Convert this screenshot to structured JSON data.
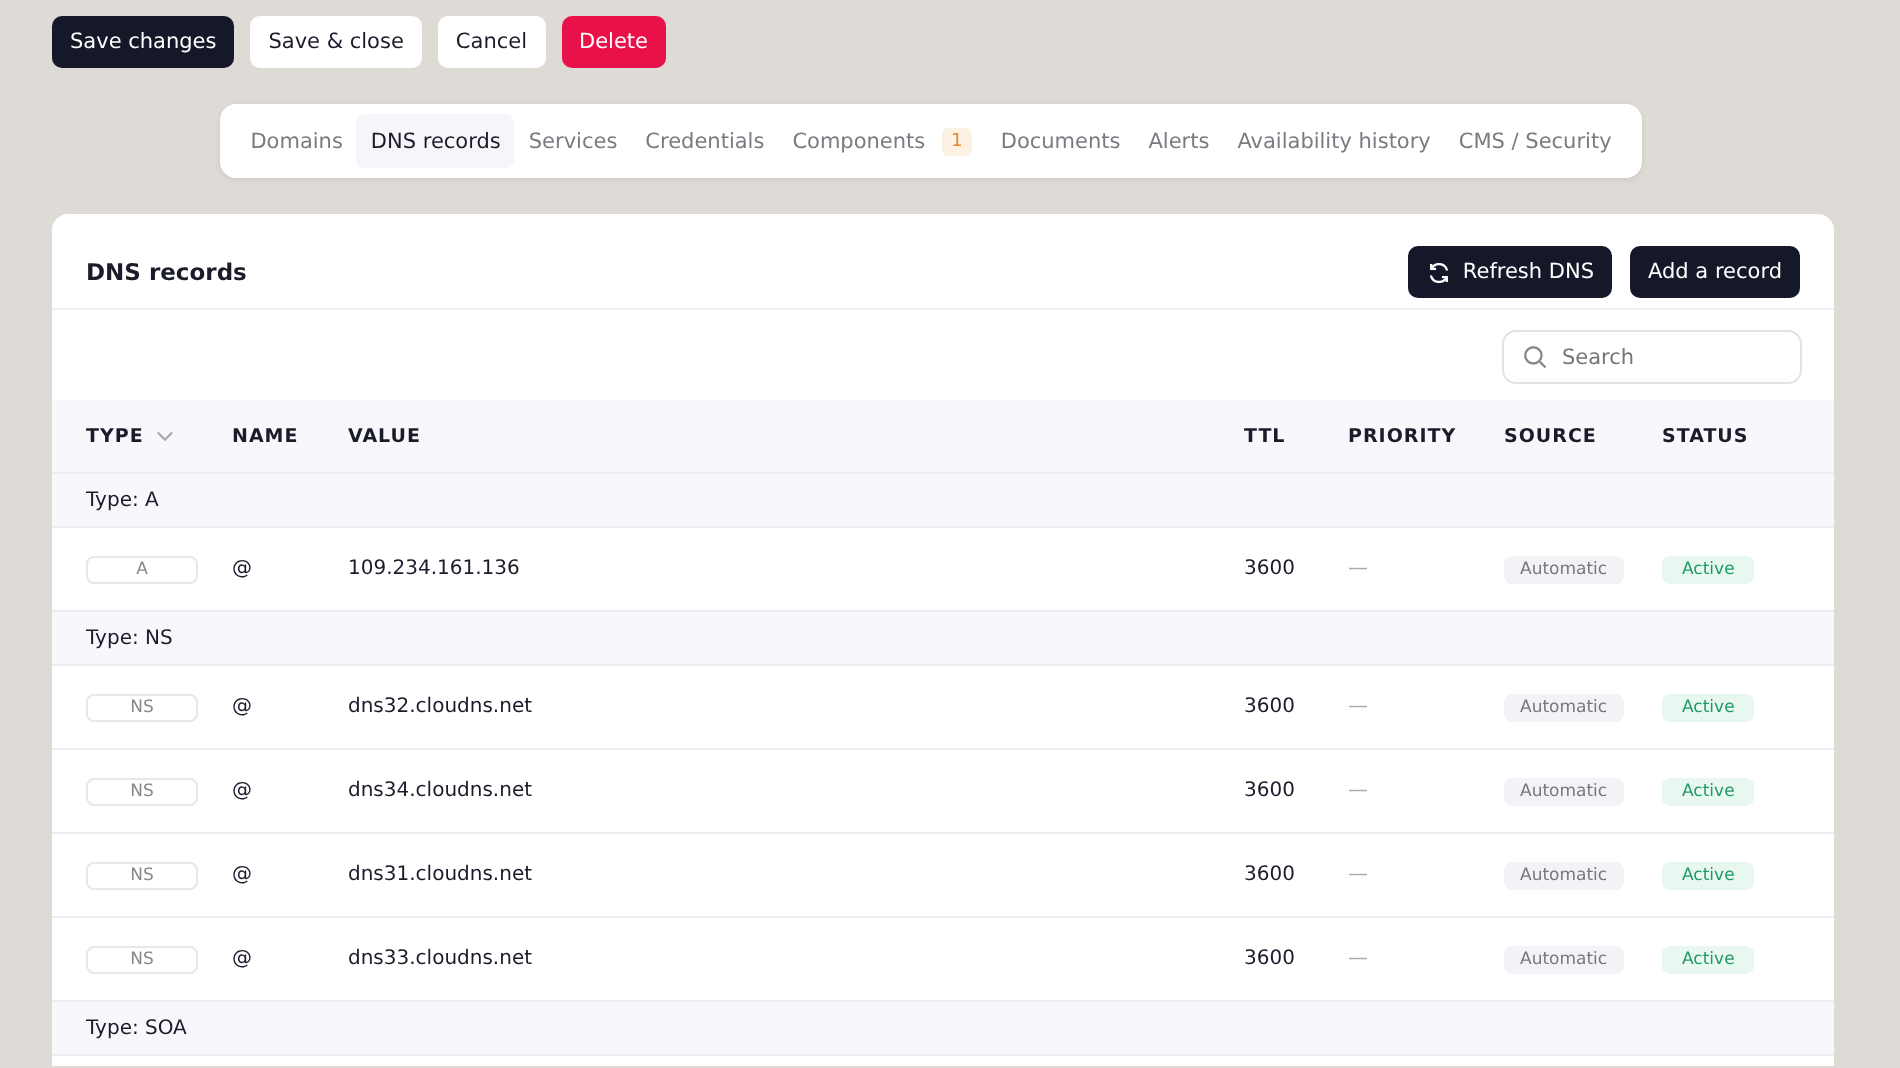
{
  "actions": [
    {
      "label": "Save changes",
      "kind": "primary"
    },
    {
      "label": "Save & close",
      "kind": "secondary"
    },
    {
      "label": "Cancel",
      "kind": "secondary"
    },
    {
      "label": "Delete",
      "kind": "danger"
    }
  ],
  "tabs": [
    {
      "label": "Domains",
      "selected": false
    },
    {
      "label": "DNS records",
      "selected": true
    },
    {
      "label": "Services",
      "selected": false
    },
    {
      "label": "Credentials",
      "selected": false
    },
    {
      "label": "Components",
      "selected": false,
      "badge": "1"
    },
    {
      "label": "Documents",
      "selected": false
    },
    {
      "label": "Alerts",
      "selected": false
    },
    {
      "label": "Availability history",
      "selected": false
    },
    {
      "label": "CMS / Security",
      "selected": false
    }
  ],
  "card": {
    "title": "DNS records",
    "buttons": [
      {
        "label": "Refresh DNS",
        "kind": "refresh"
      },
      {
        "label": "Add a record"
      }
    ],
    "search": {
      "placeholder": "Search"
    }
  },
  "table": {
    "columns": [
      {
        "label": "TYPE",
        "sortable": true
      },
      {
        "label": "NAME"
      },
      {
        "label": "VALUE"
      },
      {
        "label": "TTL"
      },
      {
        "label": "PRIORITY"
      },
      {
        "label": "SOURCE"
      },
      {
        "label": "STATUS"
      }
    ],
    "rows": [
      {
        "kind": "group",
        "label": "Type: A"
      },
      {
        "kind": "record",
        "type": "A",
        "name": "@",
        "value": "109.234.161.136",
        "ttl": "3600",
        "priority": "—",
        "source": "Automatic",
        "status": "Active"
      },
      {
        "kind": "group",
        "label": "Type: NS"
      },
      {
        "kind": "record",
        "type": "NS",
        "name": "@",
        "value": "dns32.cloudns.net",
        "ttl": "3600",
        "priority": "—",
        "source": "Automatic",
        "status": "Active"
      },
      {
        "kind": "record",
        "type": "NS",
        "name": "@",
        "value": "dns34.cloudns.net",
        "ttl": "3600",
        "priority": "—",
        "source": "Automatic",
        "status": "Active"
      },
      {
        "kind": "record",
        "type": "NS",
        "name": "@",
        "value": "dns31.cloudns.net",
        "ttl": "3600",
        "priority": "—",
        "source": "Automatic",
        "status": "Active"
      },
      {
        "kind": "record",
        "type": "NS",
        "name": "@",
        "value": "dns33.cloudns.net",
        "ttl": "3600",
        "priority": "—",
        "source": "Automatic",
        "status": "Active"
      },
      {
        "kind": "group",
        "label": "Type: SOA"
      }
    ]
  }
}
